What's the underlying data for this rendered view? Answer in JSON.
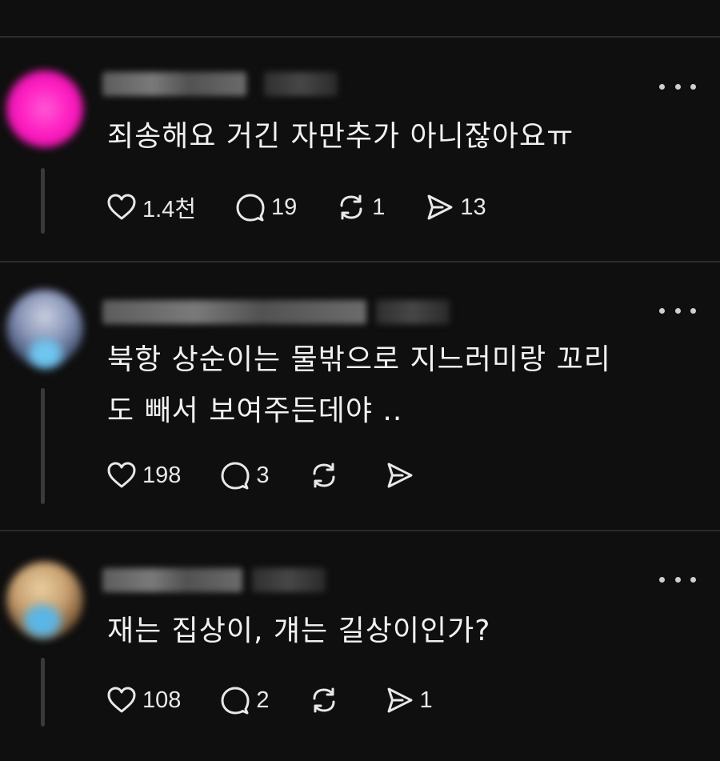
{
  "colors": {
    "background": "#0f0f0f",
    "divider": "#2c2c2c",
    "text": "#f1f1f1",
    "icon": "#e8e8e8"
  },
  "posts": [
    {
      "text": "죄송해요 거긴 자만추가 아니잖아요ㅠ",
      "avatar_color": "#ff1fc2",
      "like_count": "1.4천",
      "reply_count": "19",
      "repost_count": "1",
      "share_count": "13"
    },
    {
      "text": "북항 상순이는 물밖으로 지느러미랑 꼬리\n도 빼서 보여주든데야 ..",
      "avatar_color": "#8a96b8",
      "like_count": "198",
      "reply_count": "3",
      "repost_count": "",
      "share_count": ""
    },
    {
      "text": "재는 집상이, 걔는 길상이인가?",
      "avatar_color": "#c8a070",
      "like_count": "108",
      "reply_count": "2",
      "repost_count": "",
      "share_count": "1"
    }
  ]
}
